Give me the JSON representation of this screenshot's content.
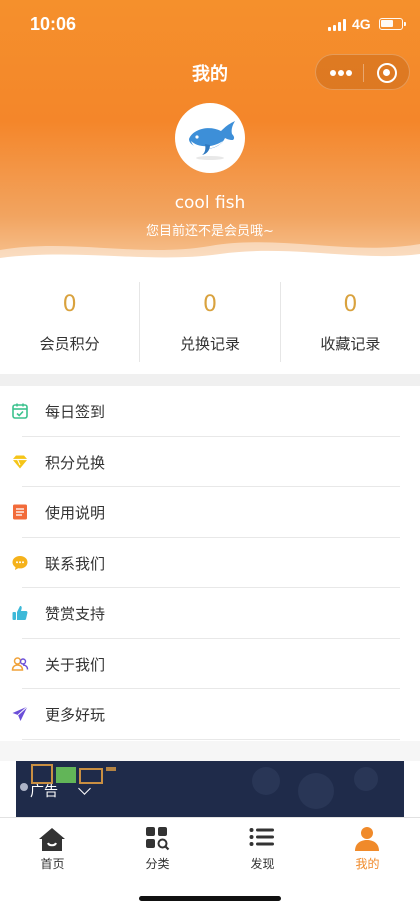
{
  "status_bar": {
    "time": "10:06",
    "network": "4G"
  },
  "nav": {
    "title": "我的"
  },
  "profile": {
    "name": "cool fish",
    "member_tip": "您目前还不是会员哦~"
  },
  "stats": [
    {
      "value": "0",
      "label": "会员积分"
    },
    {
      "value": "0",
      "label": "兑换记录"
    },
    {
      "value": "0",
      "label": "收藏记录"
    }
  ],
  "menu": [
    {
      "label": "每日签到",
      "icon": "calendar-check-icon",
      "color": "#3cc28e"
    },
    {
      "label": "积分兑换",
      "icon": "diamond-icon",
      "color": "#f5c518"
    },
    {
      "label": "使用说明",
      "icon": "notebook-icon",
      "color": "#f26b3a"
    },
    {
      "label": "联系我们",
      "icon": "chat-bubble-icon",
      "color": "#f5b21b"
    },
    {
      "label": "赞赏支持",
      "icon": "thumbs-up-icon",
      "color": "#3db9d8"
    },
    {
      "label": "关于我们",
      "icon": "people-icon",
      "color": "#f0a23a"
    },
    {
      "label": "更多好玩",
      "icon": "paper-plane-icon",
      "color": "#6b4fd8"
    }
  ],
  "ad": {
    "label": "广告"
  },
  "tabs": [
    {
      "label": "首页",
      "icon": "home-icon"
    },
    {
      "label": "分类",
      "icon": "grid-search-icon"
    },
    {
      "label": "发现",
      "icon": "list-icon"
    },
    {
      "label": "我的",
      "icon": "user-icon",
      "active": true
    }
  ],
  "colors": {
    "accent": "#f08a2a",
    "stat_value": "#d9a23e"
  }
}
